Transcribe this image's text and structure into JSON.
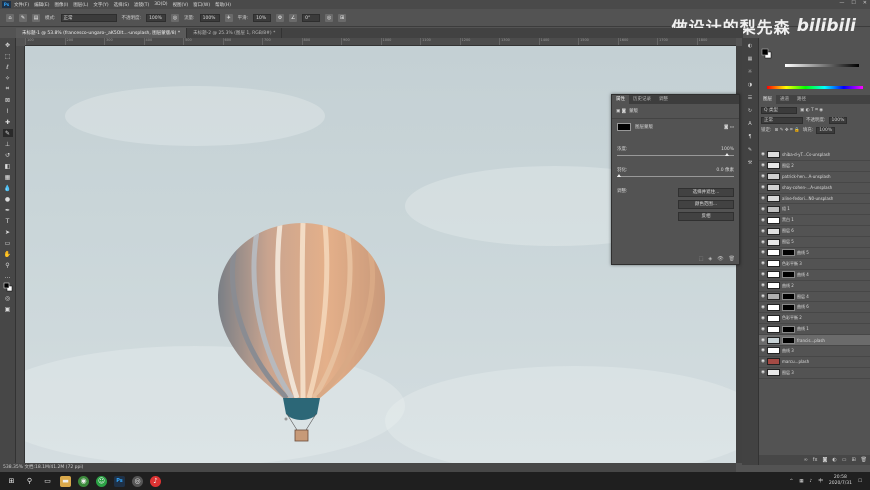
{
  "app": {
    "logo": "Ps"
  },
  "menu": [
    "文件(F)",
    "编辑(E)",
    "图像(I)",
    "图层(L)",
    "文字(Y)",
    "选择(S)",
    "滤镜(T)",
    "3D(D)",
    "视图(V)",
    "窗口(W)",
    "帮助(H)"
  ],
  "window_controls": {
    "minimize": "—",
    "maximize": "☐",
    "close": "✕"
  },
  "options_bar": {
    "mode_label": "模式:",
    "mode_value": "正常",
    "opacity_label": "不透明度:",
    "opacity_value": "100%",
    "flow_label": "流量:",
    "flow_value": "100%",
    "smooth_label": "平滑:",
    "smooth_value": "10%",
    "angle_value": "0°"
  },
  "watermark": {
    "text1": "做设计的梨先森",
    "text2": "bilibili"
  },
  "doc_tabs": [
    "未标题-1 @ 53.8% (francesco-ungaro-_aK5OIt...-unsplash, 图层蒙版/8) *",
    "未标题-2 @ 25.3% (图层 1, RGB/8#) *"
  ],
  "ruler_ticks": [
    "100",
    "200",
    "300",
    "400",
    "500",
    "600",
    "700",
    "800",
    "900",
    "1000",
    "1100",
    "1200",
    "1300",
    "1400",
    "1500",
    "1600",
    "1700",
    "1800"
  ],
  "status_bar": "538.35%  文档:18.1M/41.2M  (72 ppi)",
  "right_panel": {
    "layer_tabs": [
      "图层",
      "通道",
      "路径"
    ],
    "filter_label": "Q 类型",
    "blend_mode": "正常",
    "opacity_label": "不透明度:",
    "opacity_value": "100%",
    "lock_label": "锁定:",
    "fill_label": "填充:",
    "fill_value": "100%"
  },
  "layers": [
    {
      "name": "shiba-d-yT...Cs-unsplash",
      "thumb": "#dcdcdc",
      "mask": false,
      "sel": false
    },
    {
      "name": "图层 2",
      "thumb": "#e6e6e6",
      "mask": false,
      "sel": false
    },
    {
      "name": "patrick-hen...A-unsplash",
      "thumb": "#cfcfcf",
      "mask": false,
      "sel": false
    },
    {
      "name": "shay-cohen-...A-unsplash",
      "thumb": "#d0d0d0",
      "mask": false,
      "sel": false
    },
    {
      "name": "aline-fedori...N0-unsplash",
      "thumb": "#d8d8d8",
      "mask": false,
      "sel": false
    },
    {
      "name": "组 1",
      "thumb": "#bfbfbf",
      "mask": false,
      "sel": false
    },
    {
      "name": "黑白 1",
      "thumb": "#ffffff",
      "mask": false,
      "sel": false
    },
    {
      "name": "图层 6",
      "thumb": "#e0e0e0",
      "mask": false,
      "sel": false
    },
    {
      "name": "图层 5",
      "thumb": "#e6e6e6",
      "mask": false,
      "sel": false
    },
    {
      "name": "曲线 5",
      "thumb": "#ffffff",
      "mask": true,
      "sel": false
    },
    {
      "name": "色彩平衡 3",
      "thumb": "#ffffff",
      "mask": false,
      "sel": false
    },
    {
      "name": "曲线 4",
      "thumb": "#ffffff",
      "mask": true,
      "sel": false
    },
    {
      "name": "曲线 2",
      "thumb": "#ffffff",
      "mask": false,
      "sel": false
    },
    {
      "name": "图层 4",
      "thumb": "#b0b0b0",
      "mask": true,
      "sel": false
    },
    {
      "name": "曲线 6",
      "thumb": "#ffffff",
      "mask": true,
      "sel": false
    },
    {
      "name": "色彩平衡 2",
      "thumb": "#ffffff",
      "mask": false,
      "sel": false
    },
    {
      "name": "曲线 1",
      "thumb": "#ffffff",
      "mask": true,
      "sel": false
    },
    {
      "name": "francis...plash",
      "thumb": "#c8d2d5",
      "mask": true,
      "sel": true
    },
    {
      "name": "曲线 3",
      "thumb": "#ffffff",
      "mask": false,
      "sel": false
    },
    {
      "name": "marcu...plash",
      "thumb": "#a44a44",
      "mask": false,
      "sel": false
    },
    {
      "name": "图层 3",
      "thumb": "#e8e8e8",
      "mask": false,
      "sel": false
    }
  ],
  "properties_panel": {
    "tabs": [
      "属性",
      "历史记录",
      "调整"
    ],
    "title": "蒙版",
    "mask_type": "图层蒙版",
    "density_label": "浓度:",
    "density_value": "100%",
    "feather_label": "羽化:",
    "feather_value": "0.0 像素",
    "refine_label": "调整:",
    "btn_select_mask": "选择并遮住...",
    "btn_color_range": "颜色范围...",
    "btn_invert": "反相"
  },
  "taskbar": {
    "time": "20:58",
    "date": "2020/7/31",
    "lang": "中"
  },
  "tools": [
    "move",
    "marquee",
    "lasso",
    "quick-select",
    "crop",
    "frame",
    "eyedropper",
    "healing",
    "brush",
    "stamp",
    "history-brush",
    "eraser",
    "gradient",
    "blur",
    "dodge",
    "pen",
    "type",
    "path-select",
    "rectangle",
    "hand",
    "zoom",
    "more",
    "colors",
    "quick-mask",
    "screen-mode"
  ]
}
